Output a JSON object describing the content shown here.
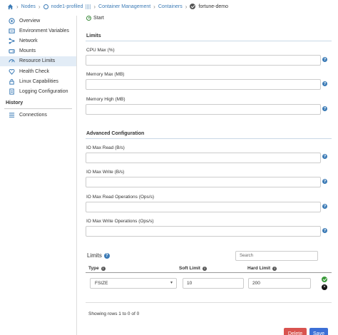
{
  "breadcrumb": {
    "home": "home-icon",
    "nodes": "Nodes",
    "node": "node1-profiled",
    "container_management": "Container Management",
    "containers": "Containers",
    "current": "fortune-demo"
  },
  "sidebar": {
    "items": [
      {
        "label": "Overview",
        "icon": "overview-icon"
      },
      {
        "label": "Environment Variables",
        "icon": "env-icon"
      },
      {
        "label": "Network",
        "icon": "network-icon"
      },
      {
        "label": "Mounts",
        "icon": "mounts-icon"
      },
      {
        "label": "Resource Limits",
        "icon": "gauge-icon"
      },
      {
        "label": "Health Check",
        "icon": "heart-icon"
      },
      {
        "label": "Linux Capabilities",
        "icon": "lock-icon"
      },
      {
        "label": "Logging Configuration",
        "icon": "log-icon"
      }
    ],
    "history_title": "History",
    "history_items": [
      {
        "label": "Connections",
        "icon": "list-icon"
      }
    ]
  },
  "main": {
    "start_label": "Start",
    "limits_section": "Limits",
    "cpu_max_label": "CPU Max (%)",
    "memory_max_label": "Memory Max (MB)",
    "memory_high_label": "Memory High (MB)",
    "advanced_section": "Advanced Configuration",
    "io_read_label": "IO Max Read (B/s)",
    "io_write_label": "IO Max Write (B/s)",
    "io_read_ops_label": "IO Max Read Operations (Ops/s)",
    "io_write_ops_label": "IO Max Write Operations (Ops/s)",
    "help_glyph": "?"
  },
  "limits_table": {
    "title": "Limits",
    "search_placeholder": "Search",
    "columns": [
      "Type",
      "Soft Limit",
      "Hard Limit"
    ],
    "rows": [
      {
        "type": "FSIZE",
        "soft": "10",
        "hard": "200"
      }
    ],
    "footer": "Showing rows 1 to 0 of 0"
  },
  "buttons": {
    "delete": "Delete",
    "save": "Save"
  },
  "colors": {
    "accent": "#3c7bb6",
    "delete": "#d9534f",
    "save": "#3c6fd6",
    "active_bg": "#e2ecf6"
  }
}
